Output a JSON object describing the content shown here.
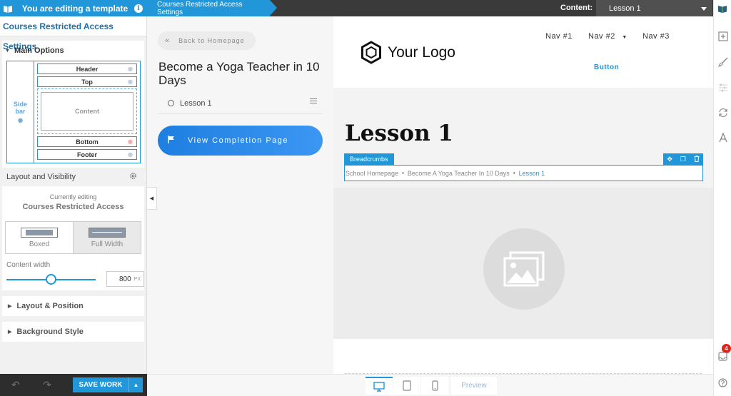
{
  "topbar": {
    "editing_label": "You are editing a template",
    "info_glyph": "i",
    "breadcrumb": "Courses Restricted Access Settings",
    "content_label": "Content:",
    "content_select_value": "Lesson 1"
  },
  "left_panel": {
    "title": "Courses Restricted Access Settings",
    "main_options": {
      "heading": "Main Options",
      "layout_map": {
        "sidebar": "Side bar",
        "header": "Header",
        "top": "Top",
        "content": "Content",
        "bottom": "Bottom",
        "footer": "Footer"
      }
    },
    "layout_visibility": "Layout and Visibility",
    "currently_editing_label": "Currently editing",
    "currently_editing_value": "Courses Restricted Access",
    "width_options": [
      {
        "label": "Boxed",
        "selected": false
      },
      {
        "label": "Full Width",
        "selected": true
      }
    ],
    "content_width_label": "Content width",
    "content_width_value": "800",
    "content_width_unit": "PX",
    "content_width_slider_fraction": 0.5,
    "collapsed_sections": [
      "Layout & Position",
      "Background Style"
    ]
  },
  "bottom_left": {
    "save_label": "SAVE WORK"
  },
  "course_sidebar": {
    "back_label": "Back to Homepage",
    "course_title": "Become a Yoga Teacher in 10 Days",
    "lessons": [
      "Lesson 1"
    ],
    "completion_button": "View Completion Page"
  },
  "page": {
    "logo_text": "Your Logo",
    "nav": [
      "Nav #1",
      "Nav #2",
      "Nav #3"
    ],
    "header_button": "Button",
    "lesson_title": "Lesson 1",
    "breadcrumbs_tag": "Breadcrumbs",
    "breadcrumbs": [
      "School Homepage",
      "Become A Yoga Teacher In 10 Days",
      "Lesson 1"
    ]
  },
  "devicebar": {
    "preview_label": "Preview",
    "selected_device": "desktop"
  },
  "right_rail": {
    "notification_count": "4"
  },
  "colors": {
    "accent": "#2196d9",
    "topbar": "#3a3a3a",
    "badge": "#e2231a"
  }
}
